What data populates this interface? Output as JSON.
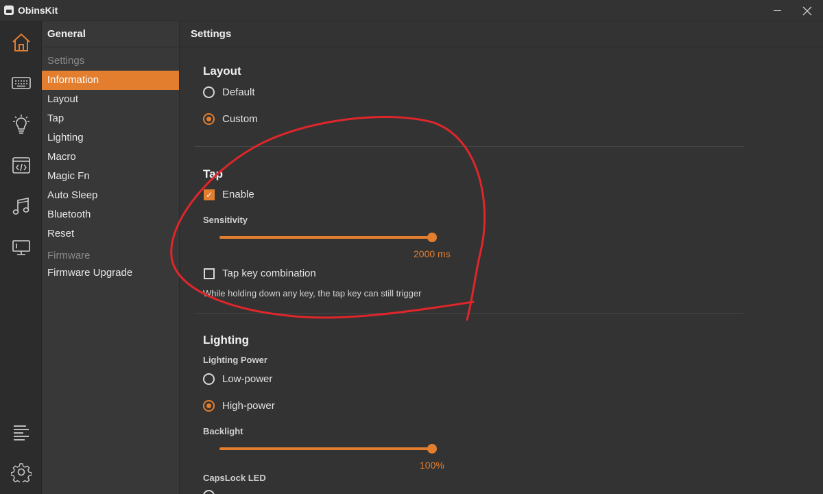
{
  "window": {
    "title": "ObinsKit"
  },
  "rail": {
    "icons": [
      "home-icon",
      "keyboard-icon",
      "lightbulb-icon",
      "code-icon",
      "music-icon",
      "monitor-icon",
      "log-icon",
      "gear-icon"
    ]
  },
  "sidebar": {
    "header": "General",
    "groups": [
      {
        "label": "Settings",
        "items": [
          "Information",
          "Layout",
          "Tap",
          "Lighting",
          "Macro",
          "Magic Fn",
          "Auto Sleep",
          "Bluetooth",
          "Reset"
        ]
      },
      {
        "label": "Firmware",
        "items": [
          "Firmware Upgrade"
        ]
      }
    ],
    "active": "Information"
  },
  "main": {
    "header": "Settings",
    "layout": {
      "title": "Layout",
      "options": [
        "Default",
        "Custom"
      ],
      "selected": "Custom"
    },
    "tap": {
      "title": "Tap",
      "enable_label": "Enable",
      "enabled": true,
      "sensitivity_label": "Sensitivity",
      "sensitivity_value": "2000 ms",
      "sensitivity_fraction": 1.0,
      "combo_label": "Tap key combination",
      "combo_checked": false,
      "combo_hint": "While holding down any key, the tap key can still trigger"
    },
    "lighting": {
      "title": "Lighting",
      "power_label": "Lighting Power",
      "power_options": [
        "Low-power",
        "High-power"
      ],
      "power_selected": "High-power",
      "backlight_label": "Backlight",
      "backlight_value": "100%",
      "backlight_fraction": 1.0,
      "capslock_label": "CapsLock LED"
    }
  },
  "colors": {
    "accent": "#e37e2f",
    "annotation": "#e0262b"
  }
}
